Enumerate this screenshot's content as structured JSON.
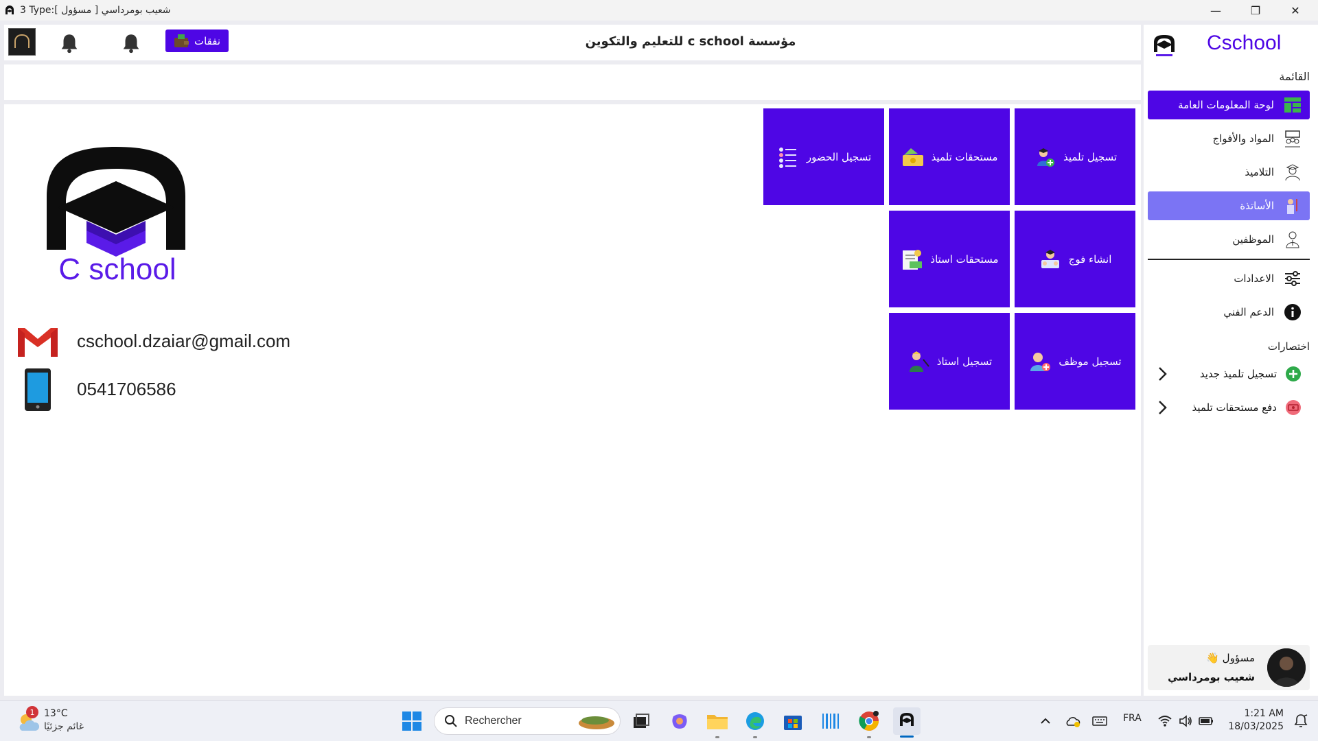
{
  "window": {
    "title": "3 Type:شعيب بومرداسي [ مسؤول ]",
    "minimize": "—",
    "restore": "❐",
    "close": "✕"
  },
  "topbar": {
    "expense_label": "نفقات",
    "org_title": "مؤسسة c school للتعليم والتكوين"
  },
  "tiles": [
    {
      "label": "تسجيل تلميذ",
      "icon": "student-add-icon"
    },
    {
      "label": "مستحقات تلميذ",
      "icon": "money-icon"
    },
    {
      "label": "تسجيل الحضور",
      "icon": "checklist-icon"
    },
    {
      "label": "انشاء فوج",
      "icon": "group-create-icon"
    },
    {
      "label": "مستحقات استاذ",
      "icon": "invoice-icon"
    },
    {
      "label": "تسجيل موظف",
      "icon": "employee-add-icon"
    },
    {
      "label": "تسجيل استاذ",
      "icon": "teacher-add-icon"
    }
  ],
  "brand": {
    "name": "C school",
    "email": "cschool.dzaiar@gmail.com",
    "phone": "0541706586"
  },
  "sidebar": {
    "brand": "Cschool",
    "menu_title": "القائمة",
    "items": [
      {
        "label": "لوحة المعلومات العامة",
        "icon": "dashboard-icon",
        "state": "active"
      },
      {
        "label": "المواد والأفواج",
        "icon": "groups-icon",
        "state": ""
      },
      {
        "label": "التلاميذ",
        "icon": "students-icon",
        "state": ""
      },
      {
        "label": "الأساتذة",
        "icon": "teachers-icon",
        "state": "selected"
      },
      {
        "label": "الموظفين",
        "icon": "employees-icon",
        "state": ""
      }
    ],
    "settings_label": "الاعدادات",
    "support_label": "الدعم الفني",
    "shortcuts_title": "اختصارات",
    "shortcuts": [
      {
        "label": "تسجيل تلميذ جديد",
        "icon": "plus-circle-icon"
      },
      {
        "label": "دفع مستحقات تلميذ",
        "icon": "cash-icon"
      }
    ],
    "user": {
      "role": "مسؤول 👋",
      "name": "شعيب بومرداسي"
    }
  },
  "taskbar": {
    "weather_temp": "13°C",
    "weather_cond": "غائم جزئيًا",
    "weather_badge": "1",
    "search_placeholder": "Rechercher",
    "lang": "FRA",
    "time": "1:21 AM",
    "date": "18/03/2025"
  },
  "colors": {
    "accent": "#4e06e5",
    "selected": "#7b74f4",
    "brand_text": "#5a1be8"
  }
}
